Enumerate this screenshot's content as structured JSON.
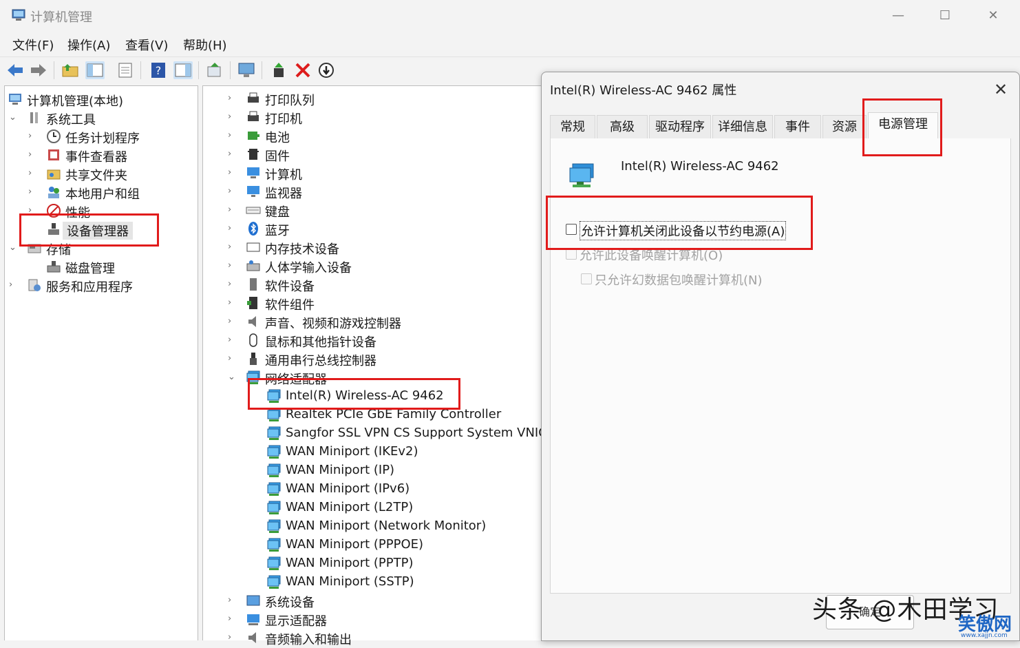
{
  "window": {
    "title": "计算机管理",
    "minimize": "—",
    "maximize": "☐",
    "close": "✕"
  },
  "menu": [
    "文件(F)",
    "操作(A)",
    "查看(V)",
    "帮助(H)"
  ],
  "left_tree": [
    {
      "label": "计算机管理(本地)",
      "arrow": "",
      "icon": "computer-management-icon"
    },
    {
      "label": "系统工具",
      "arrow": "⌄",
      "icon": "system-tools-icon"
    },
    {
      "label": "任务计划程序",
      "arrow": "›",
      "icon": "clock-icon"
    },
    {
      "label": "事件查看器",
      "arrow": "›",
      "icon": "event-viewer-icon"
    },
    {
      "label": "共享文件夹",
      "arrow": "›",
      "icon": "shared-folder-icon"
    },
    {
      "label": "本地用户和组",
      "arrow": "›",
      "icon": "users-icon"
    },
    {
      "label": "性能",
      "arrow": "›",
      "icon": "performance-icon"
    },
    {
      "label": "设备管理器",
      "arrow": "",
      "icon": "device-manager-icon"
    },
    {
      "label": "存储",
      "arrow": "⌄",
      "icon": "storage-icon"
    },
    {
      "label": "磁盘管理",
      "arrow": "",
      "icon": "disk-management-icon"
    },
    {
      "label": "服务和应用程序",
      "arrow": "›",
      "icon": "services-icon"
    }
  ],
  "device_categories": [
    {
      "label": "打印队列",
      "arrow": "›",
      "icon": "printer-icon"
    },
    {
      "label": "打印机",
      "arrow": "›",
      "icon": "printer-icon"
    },
    {
      "label": "电池",
      "arrow": "›",
      "icon": "battery-icon"
    },
    {
      "label": "固件",
      "arrow": "›",
      "icon": "firmware-icon"
    },
    {
      "label": "计算机",
      "arrow": "›",
      "icon": "computer-icon"
    },
    {
      "label": "监视器",
      "arrow": "›",
      "icon": "monitor-icon"
    },
    {
      "label": "键盘",
      "arrow": "›",
      "icon": "keyboard-icon"
    },
    {
      "label": "蓝牙",
      "arrow": "›",
      "icon": "bluetooth-icon"
    },
    {
      "label": "内存技术设备",
      "arrow": "›",
      "icon": "memory-icon"
    },
    {
      "label": "人体学输入设备",
      "arrow": "›",
      "icon": "hid-icon"
    },
    {
      "label": "软件设备",
      "arrow": "›",
      "icon": "software-device-icon"
    },
    {
      "label": "软件组件",
      "arrow": "›",
      "icon": "software-component-icon"
    },
    {
      "label": "声音、视频和游戏控制器",
      "arrow": "›",
      "icon": "speaker-icon"
    },
    {
      "label": "鼠标和其他指针设备",
      "arrow": "›",
      "icon": "mouse-icon"
    },
    {
      "label": "通用串行总线控制器",
      "arrow": "›",
      "icon": "usb-icon"
    },
    {
      "label": "网络适配器",
      "arrow": "⌄",
      "icon": "network-adapter-icon"
    }
  ],
  "network_adapters": [
    "Intel(R) Wireless-AC 9462",
    "Realtek PCIe GbE Family Controller",
    "Sangfor SSL VPN CS Support System VNIC",
    "WAN Miniport (IKEv2)",
    "WAN Miniport (IP)",
    "WAN Miniport (IPv6)",
    "WAN Miniport (L2TP)",
    "WAN Miniport (Network Monitor)",
    "WAN Miniport (PPPOE)",
    "WAN Miniport (PPTP)",
    "WAN Miniport (SSTP)"
  ],
  "device_categories_after": [
    {
      "label": "系统设备",
      "arrow": "›",
      "icon": "system-device-icon"
    },
    {
      "label": "显示适配器",
      "arrow": "›",
      "icon": "display-adapter-icon"
    },
    {
      "label": "音频输入和输出",
      "arrow": "›",
      "icon": "audio-io-icon"
    }
  ],
  "dialog": {
    "title": "Intel(R) Wireless-AC 9462 属性",
    "close": "✕",
    "tabs": [
      "常规",
      "高级",
      "驱动程序",
      "详细信息",
      "事件",
      "资源",
      "电源管理"
    ],
    "active_tab": "电源管理",
    "device_name": "Intel(R) Wireless-AC 9462",
    "options": [
      {
        "label": "允许计算机关闭此设备以节约电源(A)",
        "checked": false,
        "enabled": true
      },
      {
        "label": "允许此设备唤醒计算机(O)",
        "checked": false,
        "enabled": false
      },
      {
        "label": "只允许幻数据包唤醒计算机(N)",
        "checked": false,
        "enabled": false
      }
    ],
    "ok_button": "确定"
  },
  "watermark": {
    "text": "头条 @木田学习",
    "site_logo": "笑傲网",
    "site_url": "www.xajjn.com"
  },
  "colors": {
    "highlight_box": "#e11b1b",
    "selection": "#e5e5e5",
    "accent_blue": "#1f66c4"
  }
}
